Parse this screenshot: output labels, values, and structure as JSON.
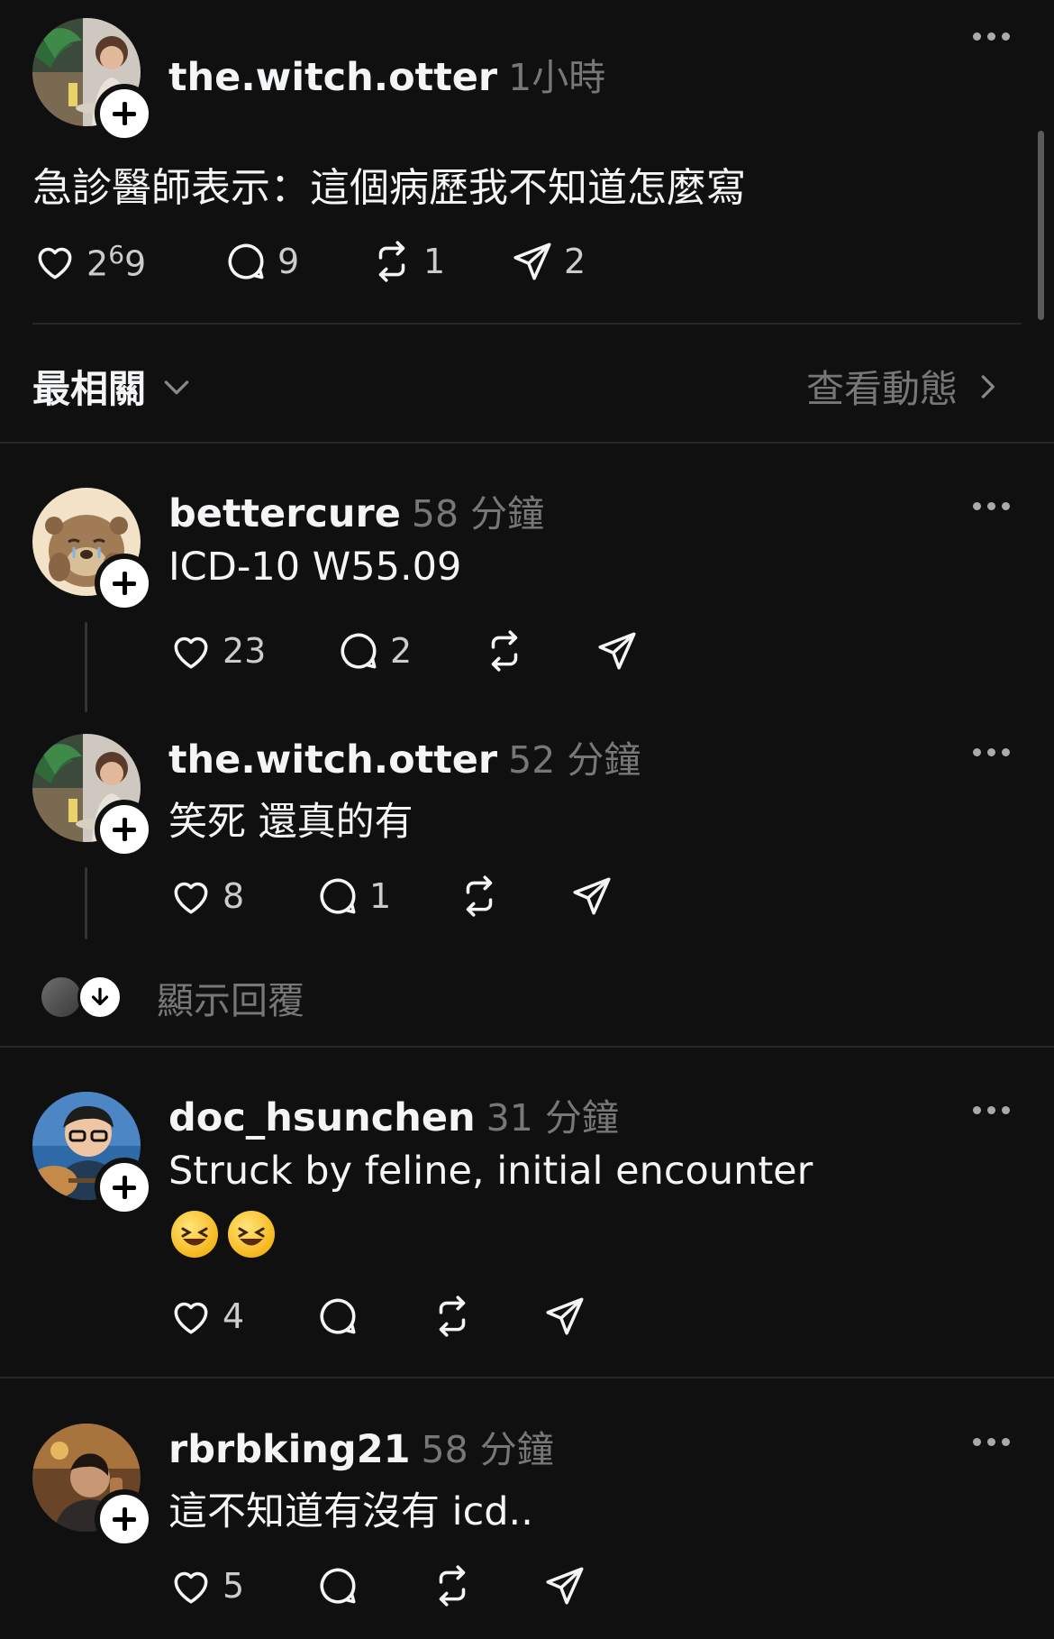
{
  "post": {
    "username": "the.witch.otter",
    "time": "1小時",
    "text": "急診醫師表示：這個病歷我不知道怎麼寫",
    "likes_a": "2",
    "likes_sup": "6",
    "likes_b": "9",
    "replies": "9",
    "reposts": "1",
    "shares": "2"
  },
  "sort": {
    "label": "最相關",
    "activity_link": "查看動態"
  },
  "comments": [
    {
      "username": "bettercure",
      "time": "58 分鐘",
      "text": "ICD-10 W55.09",
      "likes": "23",
      "replies": "2"
    },
    {
      "username": "the.witch.otter",
      "time": "52 分鐘",
      "text": "笑死 還真的有",
      "likes": "8",
      "replies": "1"
    },
    {
      "username": "doc_hsunchen",
      "time": "31 分鐘",
      "text": "Struck by feline, initial encounter",
      "likes": "4"
    },
    {
      "username": "rbrbking21",
      "time": "58 分鐘",
      "text": "這不知道有沒有 icd..",
      "likes": "5"
    }
  ],
  "show_replies": "顯示回覆",
  "icons": [
    "heart-icon",
    "comment-icon",
    "repost-icon",
    "share-icon",
    "more-icon",
    "chevron-down-icon",
    "chevron-right-icon",
    "arrow-down-icon",
    "follow-plus-icon"
  ],
  "colors": {
    "background": "#101010",
    "text_primary": "#f3f5f7",
    "text_secondary": "#777777",
    "divider": "#262626"
  }
}
